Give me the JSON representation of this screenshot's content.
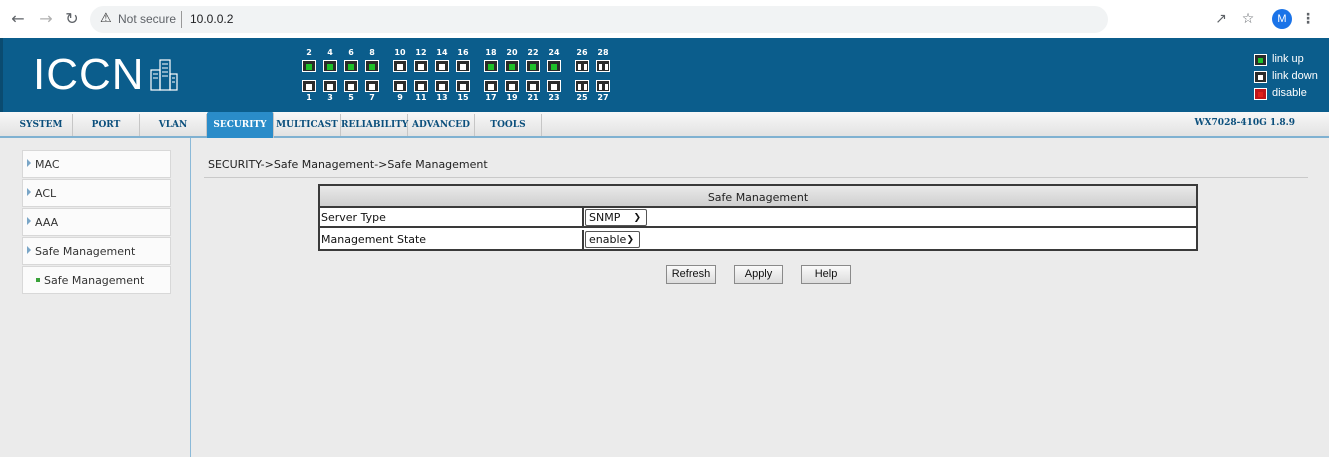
{
  "browser": {
    "security_label": "Not secure",
    "url": "10.0.0.2",
    "profile_initial": "M"
  },
  "header": {
    "logo": "ICCN",
    "ports": {
      "top_labels": [
        "2",
        "4",
        "6",
        "8",
        "10",
        "12",
        "14",
        "16",
        "18",
        "20",
        "22",
        "24",
        "26",
        "28"
      ],
      "bottom_labels": [
        "1",
        "3",
        "5",
        "7",
        "9",
        "11",
        "13",
        "15",
        "17",
        "19",
        "21",
        "23",
        "25",
        "27"
      ],
      "link_up_ports_top": [
        "2",
        "4",
        "6",
        "8",
        "18",
        "20",
        "22",
        "24"
      ]
    },
    "legend": {
      "link_up": "link up",
      "link_down": "link down",
      "disable": "disable"
    }
  },
  "tabs": [
    "SYSTEM",
    "PORT",
    "VLAN",
    "SECURITY",
    "MULTICAST",
    "RELIABILITY",
    "ADVANCED",
    "TOOLS"
  ],
  "active_tab": "SECURITY",
  "version": "WX7028-410G 1.8.9",
  "sidebar": {
    "items": [
      {
        "label": "MAC"
      },
      {
        "label": "ACL"
      },
      {
        "label": "AAA"
      },
      {
        "label": "Safe Management"
      }
    ],
    "sub_items": [
      {
        "label": "Safe Management"
      }
    ]
  },
  "main": {
    "breadcrumb": "SECURITY->Safe Management->Safe Management",
    "panel_title": "Safe Management",
    "rows": [
      {
        "label": "Server Type",
        "value": "SNMP"
      },
      {
        "label": "Management State",
        "value": "enable"
      }
    ],
    "buttons": {
      "refresh": "Refresh",
      "apply": "Apply",
      "help": "Help"
    }
  },
  "colors": {
    "banner": "#0b5d8c",
    "active_tab": "#2a8cc9",
    "link_up": "#1ec02a",
    "disable": "#e0201b"
  }
}
